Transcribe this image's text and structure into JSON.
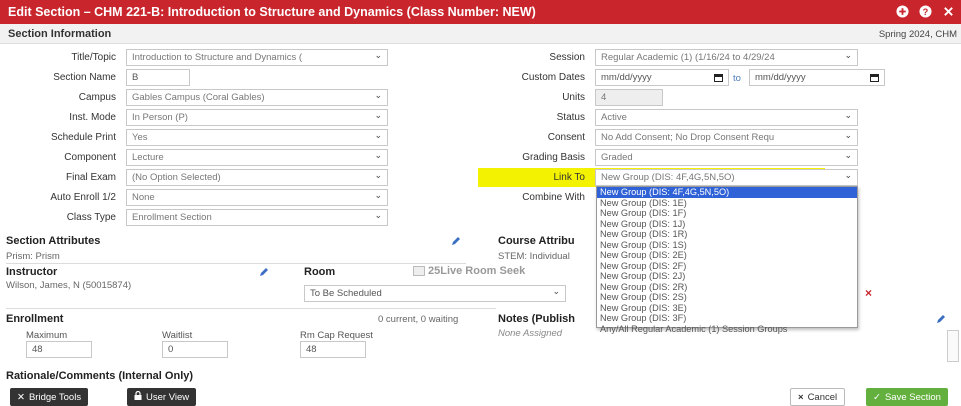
{
  "window": {
    "title": "Edit Section – CHM 221-B: Introduction to Structure and Dynamics (Class Number: NEW)",
    "controls": [
      "plus-circle-icon",
      "help-circle-icon",
      "close-icon"
    ]
  },
  "section_info": {
    "heading": "Section Information",
    "term": "Spring 2024, CHM"
  },
  "left_fields": [
    {
      "label": "Title/Topic",
      "value": "Introduction to Structure and Dynamics (",
      "type": "select"
    },
    {
      "label": "Section Name",
      "value": "B",
      "type": "text"
    },
    {
      "label": "Campus",
      "value": "Gables Campus (Coral Gables)",
      "type": "select"
    },
    {
      "label": "Inst. Mode",
      "value": "In Person (P)",
      "type": "select"
    },
    {
      "label": "Schedule Print",
      "value": "Yes",
      "type": "select"
    },
    {
      "label": "Component",
      "value": "Lecture",
      "type": "select"
    },
    {
      "label": "Final Exam",
      "value": "(No Option Selected)",
      "type": "select"
    },
    {
      "label": "Auto Enroll 1/2",
      "value": "None",
      "type": "select"
    },
    {
      "label": "Class Type",
      "value": "Enrollment Section",
      "type": "select"
    }
  ],
  "right_fields": {
    "session": {
      "label": "Session",
      "value": "Regular Academic (1) (1/16/24 to 4/29/24"
    },
    "custom_dates": {
      "label": "Custom Dates",
      "start_placeholder": "mm/dd/yyyy",
      "to": "to",
      "end_placeholder": "mm/dd/yyyy"
    },
    "units": {
      "label": "Units",
      "value": "4"
    },
    "status": {
      "label": "Status",
      "value": "Active"
    },
    "consent": {
      "label": "Consent",
      "value": "No Add Consent; No Drop Consent Requ"
    },
    "grading": {
      "label": "Grading Basis",
      "value": "Graded"
    },
    "link_to": {
      "label": "Link To",
      "value": "New Group (DIS: 4F,4G,5N,5O)"
    },
    "combine_with": {
      "label": "Combine With"
    }
  },
  "link_to_options": [
    "New Group (DIS: 4F,4G,5N,5O)",
    "New Group (DIS: 1E)",
    "New Group (DIS: 1F)",
    "New Group (DIS: 1J)",
    "New Group (DIS: 1R)",
    "New Group (DIS: 1S)",
    "New Group (DIS: 2E)",
    "New Group (DIS: 2F)",
    "New Group (DIS: 2J)",
    "New Group (DIS: 2R)",
    "New Group (DIS: 2S)",
    "New Group (DIS: 3E)",
    "New Group (DIS: 3F)",
    "Any/All Regular Academic (1) Session Groups"
  ],
  "section_attributes": {
    "heading": "Section Attributes",
    "value": "Prism: Prism"
  },
  "course_attributes": {
    "heading": "Course Attribu",
    "value": "STEM: Individual"
  },
  "instructor": {
    "heading": "Instructor",
    "value": "Wilson, James, N (50015874)"
  },
  "room": {
    "heading": "Room",
    "seek_label": "25Live Room Seek",
    "value": "To Be Scheduled"
  },
  "enrollment": {
    "heading": "Enrollment",
    "summary": "0 current, 0 waiting",
    "maximum_label": "Maximum",
    "maximum_value": "48",
    "waitlist_label": "Waitlist",
    "waitlist_value": "0",
    "rmcap_label": "Rm Cap Request",
    "rmcap_value": "48"
  },
  "notes": {
    "heading": "Notes (Publish",
    "value": "None Assigned"
  },
  "rationale": {
    "heading": "Rationale/Comments (Internal Only)"
  },
  "buttons": {
    "bridge_tools": "Bridge Tools",
    "user_view": "User View",
    "cancel": "Cancel",
    "save": "Save Section"
  },
  "colors": {
    "titlebar": "#c9252c",
    "highlight": "#f3f200",
    "selected": "#2f62d6",
    "save": "#63b03e"
  }
}
